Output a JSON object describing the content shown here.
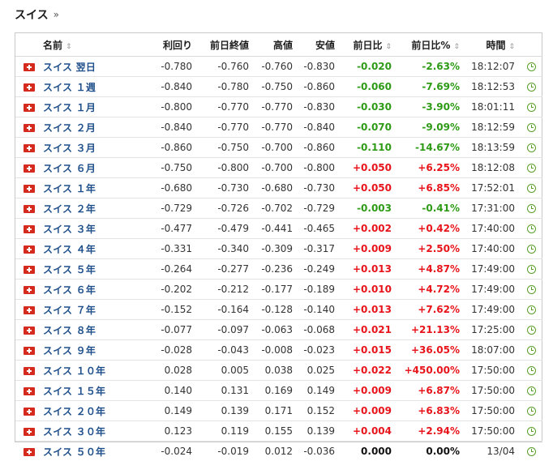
{
  "header": {
    "title": "スイス",
    "arrow": "»"
  },
  "columns": {
    "name": "名前",
    "yield": "利回り",
    "prev_close": "前日終値",
    "high": "高値",
    "low": "安値",
    "change": "前日比",
    "change_pct": "前日比%",
    "time": "時間",
    "sort_glyph": "⇕"
  },
  "colors": {
    "up": "#e8141b",
    "down": "#2e9b16",
    "flat": "#111111",
    "link": "#1f4f8a"
  },
  "icons": {
    "flag": "swiss-flag-icon",
    "clock": "clock-icon"
  },
  "rows": [
    {
      "name": "スイス 翌日",
      "yield": "-0.780",
      "prev": "-0.760",
      "high": "-0.760",
      "low": "-0.830",
      "chg": "-0.020",
      "pct": "-2.63%",
      "time": "18:12:07",
      "dir": "down"
    },
    {
      "name": "スイス １週",
      "yield": "-0.840",
      "prev": "-0.780",
      "high": "-0.750",
      "low": "-0.860",
      "chg": "-0.060",
      "pct": "-7.69%",
      "time": "18:12:53",
      "dir": "down"
    },
    {
      "name": "スイス １月",
      "yield": "-0.800",
      "prev": "-0.770",
      "high": "-0.770",
      "low": "-0.830",
      "chg": "-0.030",
      "pct": "-3.90%",
      "time": "18:01:11",
      "dir": "down"
    },
    {
      "name": "スイス ２月",
      "yield": "-0.840",
      "prev": "-0.770",
      "high": "-0.770",
      "low": "-0.840",
      "chg": "-0.070",
      "pct": "-9.09%",
      "time": "18:12:59",
      "dir": "down"
    },
    {
      "name": "スイス ３月",
      "yield": "-0.860",
      "prev": "-0.750",
      "high": "-0.700",
      "low": "-0.860",
      "chg": "-0.110",
      "pct": "-14.67%",
      "time": "18:13:59",
      "dir": "down"
    },
    {
      "name": "スイス ６月",
      "yield": "-0.750",
      "prev": "-0.800",
      "high": "-0.700",
      "low": "-0.800",
      "chg": "+0.050",
      "pct": "+6.25%",
      "time": "18:12:08",
      "dir": "up"
    },
    {
      "name": "スイス １年",
      "yield": "-0.680",
      "prev": "-0.730",
      "high": "-0.680",
      "low": "-0.730",
      "chg": "+0.050",
      "pct": "+6.85%",
      "time": "17:52:01",
      "dir": "up"
    },
    {
      "name": "スイス ２年",
      "yield": "-0.729",
      "prev": "-0.726",
      "high": "-0.702",
      "low": "-0.729",
      "chg": "-0.003",
      "pct": "-0.41%",
      "time": "17:31:00",
      "dir": "down"
    },
    {
      "name": "スイス ３年",
      "yield": "-0.477",
      "prev": "-0.479",
      "high": "-0.441",
      "low": "-0.465",
      "chg": "+0.002",
      "pct": "+0.42%",
      "time": "17:40:00",
      "dir": "up"
    },
    {
      "name": "スイス ４年",
      "yield": "-0.331",
      "prev": "-0.340",
      "high": "-0.309",
      "low": "-0.317",
      "chg": "+0.009",
      "pct": "+2.50%",
      "time": "17:40:00",
      "dir": "up"
    },
    {
      "name": "スイス ５年",
      "yield": "-0.264",
      "prev": "-0.277",
      "high": "-0.236",
      "low": "-0.249",
      "chg": "+0.013",
      "pct": "+4.87%",
      "time": "17:49:00",
      "dir": "up"
    },
    {
      "name": "スイス ６年",
      "yield": "-0.202",
      "prev": "-0.212",
      "high": "-0.177",
      "low": "-0.189",
      "chg": "+0.010",
      "pct": "+4.72%",
      "time": "17:49:00",
      "dir": "up"
    },
    {
      "name": "スイス ７年",
      "yield": "-0.152",
      "prev": "-0.164",
      "high": "-0.128",
      "low": "-0.140",
      "chg": "+0.013",
      "pct": "+7.62%",
      "time": "17:49:00",
      "dir": "up"
    },
    {
      "name": "スイス ８年",
      "yield": "-0.077",
      "prev": "-0.097",
      "high": "-0.063",
      "low": "-0.068",
      "chg": "+0.021",
      "pct": "+21.13%",
      "time": "17:25:00",
      "dir": "up"
    },
    {
      "name": "スイス ９年",
      "yield": "-0.028",
      "prev": "-0.043",
      "high": "-0.008",
      "low": "-0.023",
      "chg": "+0.015",
      "pct": "+36.05%",
      "time": "18:07:00",
      "dir": "up"
    },
    {
      "name": "スイス １０年",
      "yield": "0.028",
      "prev": "0.005",
      "high": "0.038",
      "low": "0.025",
      "chg": "+0.022",
      "pct": "+450.00%",
      "time": "17:50:00",
      "dir": "up"
    },
    {
      "name": "スイス １５年",
      "yield": "0.140",
      "prev": "0.131",
      "high": "0.169",
      "low": "0.149",
      "chg": "+0.009",
      "pct": "+6.87%",
      "time": "17:50:00",
      "dir": "up"
    },
    {
      "name": "スイス ２０年",
      "yield": "0.149",
      "prev": "0.139",
      "high": "0.171",
      "low": "0.152",
      "chg": "+0.009",
      "pct": "+6.83%",
      "time": "17:50:00",
      "dir": "up"
    },
    {
      "name": "スイス ３０年",
      "yield": "0.123",
      "prev": "0.119",
      "high": "0.155",
      "low": "0.139",
      "chg": "+0.004",
      "pct": "+2.94%",
      "time": "17:50:00",
      "dir": "up"
    },
    {
      "name": "スイス ５０年",
      "yield": "-0.024",
      "prev": "-0.019",
      "high": "0.012",
      "low": "-0.036",
      "chg": "0.000",
      "pct": "0.00%",
      "time": "13/04",
      "dir": "flat"
    }
  ]
}
